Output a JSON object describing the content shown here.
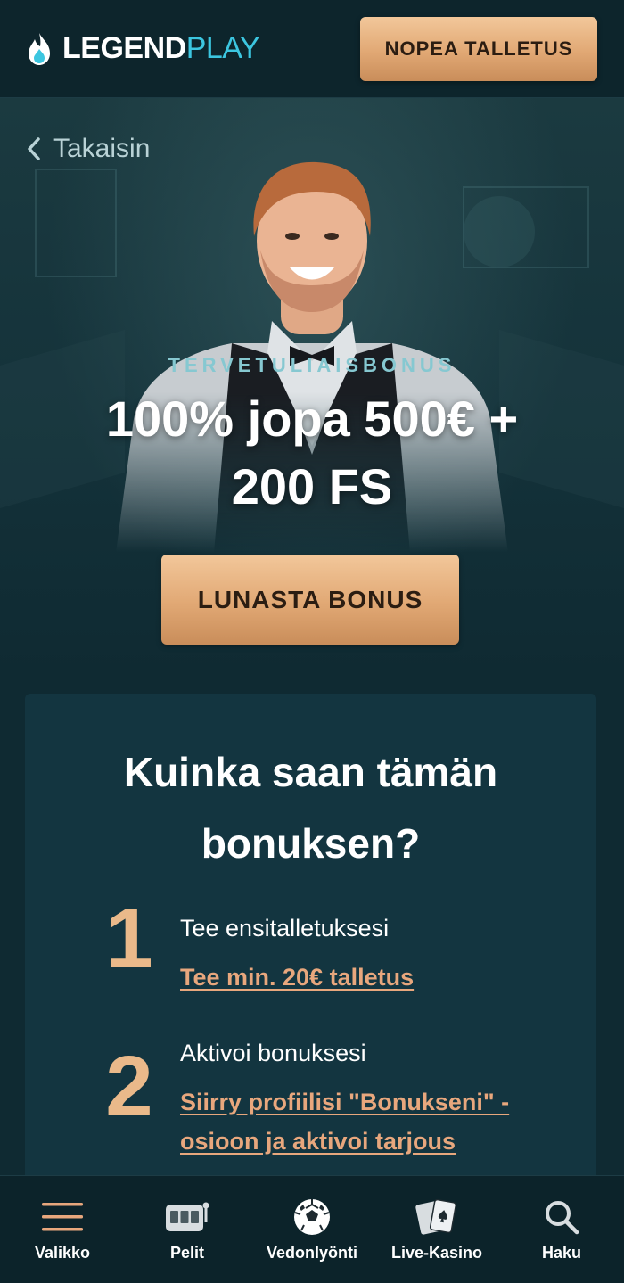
{
  "header": {
    "logo_part1": "LEGEND",
    "logo_part2": "PLAY",
    "quick_deposit": "NOPEA TALLETUS"
  },
  "hero": {
    "back": "Takaisin",
    "kicker": "TERVETULIAISBONUS",
    "title_line1": "100% jopa 500€ +",
    "title_line2": "200 FS",
    "cta": "LUNASTA BONUS"
  },
  "howto": {
    "title_line1": "Kuinka saan tämän",
    "title_line2": "bonuksen?",
    "steps": [
      {
        "number": "1",
        "title": "Tee ensitalletuksesi",
        "link_line1": "Tee min. 20€ talletus",
        "link_line2": ""
      },
      {
        "number": "2",
        "title": "Aktivoi bonuksesi",
        "link_line1": "Siirry profiilisi \"Bonukseni\" -",
        "link_line2": "osioon ja aktivoi tarjous"
      }
    ]
  },
  "nav": {
    "items": [
      {
        "label": "Valikko",
        "icon": "menu-icon"
      },
      {
        "label": "Pelit",
        "icon": "slot-machine-icon"
      },
      {
        "label": "Vedonlyönti",
        "icon": "soccer-ball-icon"
      },
      {
        "label": "Live-Kasino",
        "icon": "cards-icon"
      },
      {
        "label": "Haku",
        "icon": "search-icon"
      }
    ]
  },
  "colors": {
    "background": "#0f2a32",
    "accent_gold": "#e1a874",
    "logo_blue": "#3cc6e0",
    "link": "#e8a77d"
  }
}
